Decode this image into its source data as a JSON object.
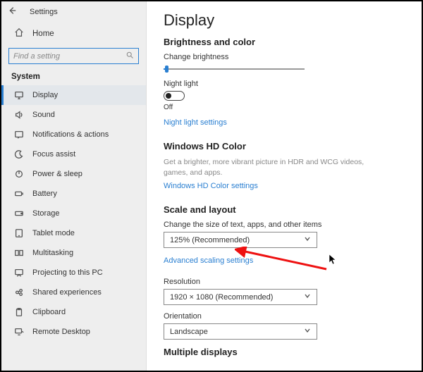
{
  "app_title": "Settings",
  "home_label": "Home",
  "search": {
    "placeholder": "Find a setting"
  },
  "sidebar_header": "System",
  "sidebar": {
    "items": [
      {
        "label": "Display",
        "icon": "monitor-icon",
        "active": true
      },
      {
        "label": "Sound",
        "icon": "sound-icon"
      },
      {
        "label": "Notifications & actions",
        "icon": "notifications-icon"
      },
      {
        "label": "Focus assist",
        "icon": "moon-icon"
      },
      {
        "label": "Power & sleep",
        "icon": "power-icon"
      },
      {
        "label": "Battery",
        "icon": "battery-icon"
      },
      {
        "label": "Storage",
        "icon": "storage-icon"
      },
      {
        "label": "Tablet mode",
        "icon": "tablet-icon"
      },
      {
        "label": "Multitasking",
        "icon": "multitasking-icon"
      },
      {
        "label": "Projecting to this PC",
        "icon": "projecting-icon"
      },
      {
        "label": "Shared experiences",
        "icon": "shared-icon"
      },
      {
        "label": "Clipboard",
        "icon": "clipboard-icon"
      },
      {
        "label": "Remote Desktop",
        "icon": "remote-icon"
      }
    ]
  },
  "page_title": "Display",
  "sections": {
    "brightness_color": {
      "title": "Brightness and color",
      "change_brightness": "Change brightness",
      "night_light_label": "Night light",
      "night_light_state": "Off",
      "night_light_link": "Night light settings"
    },
    "hd_color": {
      "title": "Windows HD Color",
      "desc": "Get a brighter, more vibrant picture in HDR and WCG videos, games, and apps.",
      "link": "Windows HD Color settings"
    },
    "scale_layout": {
      "title": "Scale and layout",
      "scale_label": "Change the size of text, apps, and other items",
      "scale_value": "125% (Recommended)",
      "advanced_link": "Advanced scaling settings",
      "resolution_label": "Resolution",
      "resolution_value": "1920 × 1080 (Recommended)",
      "orientation_label": "Orientation",
      "orientation_value": "Landscape"
    },
    "multiple_displays": {
      "title": "Multiple displays"
    }
  }
}
